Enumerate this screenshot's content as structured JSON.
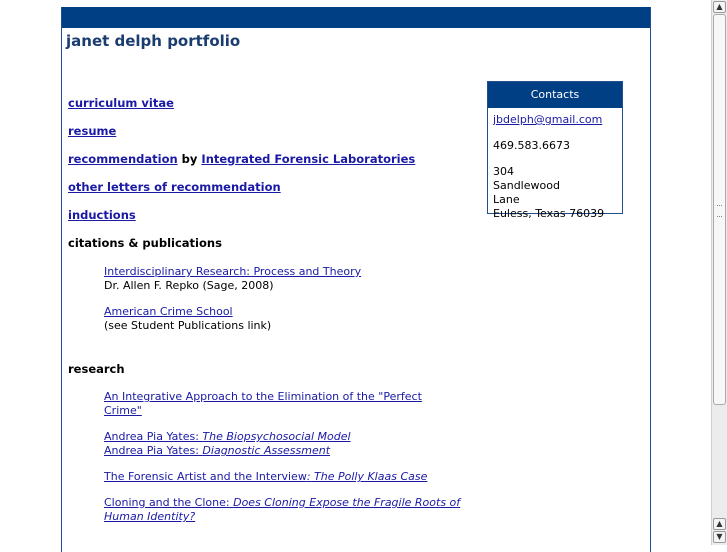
{
  "site": {
    "title": "janet delph portfolio"
  },
  "nav": {
    "cv": "curriculum vitae",
    "resume": "resume",
    "recommendation": "recommendation",
    "by": " by ",
    "lab": "Integrated Forensic Laboratories",
    "other_letters": "other letters of recommendation",
    "inductions": "inductions"
  },
  "citations": {
    "heading": "citations & publications",
    "items": [
      {
        "link": "Interdisciplinary Research: Process and Theory",
        "note": "Dr. Allen F. Repko (Sage, 2008)"
      },
      {
        "link": "American Crime School",
        "note": "(see Student Publications link)"
      }
    ]
  },
  "research": {
    "heading": "research",
    "item1": "An Integrative Approach to the Elimination of the \"Perfect Crime\"",
    "item2a_plain": "Andrea Pia Yates: ",
    "item2a_italic": "The Biopsychosocial Model ",
    "item2b_plain": "Andrea Pia Yates:  ",
    "item2b_italic": "Diagnostic Assessment",
    "item3_plain": "The Forensic Artist and the Interview",
    "item3_italic": ": The Polly Klaas Case",
    "item4_plain": "Cloning and the Clone:  ",
    "item4_italic": "Does Cloning Expose the Fragile Roots of Human Identity?"
  },
  "contacts": {
    "heading": "Contacts",
    "email": "jbdelph@gmail.com",
    "phone": "469.583.6673",
    "address_line1": "304 Sandlewood Lane",
    "address_line2": "Euless, Texas 76039"
  },
  "scrollbar": {
    "up": "▲",
    "down": "▼",
    "position": 0
  }
}
